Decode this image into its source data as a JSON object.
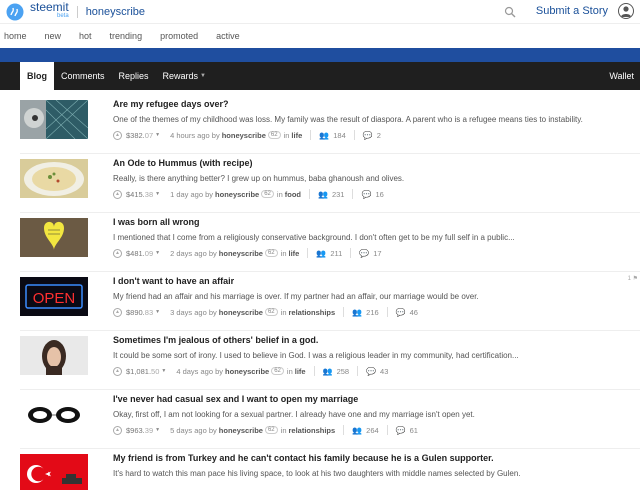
{
  "header": {
    "brand": "steemit",
    "beta": "beta",
    "account": "honeyscribe",
    "submit_label": "Submit a Story",
    "icons": [
      "steem-logo-icon",
      "search-icon",
      "user-avatar-icon"
    ]
  },
  "subnav": [
    "home",
    "new",
    "hot",
    "trending",
    "promoted",
    "active"
  ],
  "tabs": {
    "items": [
      "Blog",
      "Comments",
      "Replies",
      "Rewards"
    ],
    "active": "Blog",
    "wallet": "Wallet"
  },
  "colors": {
    "banner": "#1f4e9f",
    "tabbar": "#1f1f1f",
    "link": "#1a5099"
  },
  "posts": [
    {
      "title": "Are my refugee days over?",
      "body": "One of the themes of my childhood was loss. My family was the result of diaspora. A parent who is a refugee means ties to instability.",
      "payout_main": "$382.",
      "payout_cents": "07",
      "time": "4 hours ago by",
      "author": "honeyscribe",
      "rep": "62",
      "in": "in",
      "category": "life",
      "votes": "184",
      "comments": "2",
      "flag": ""
    },
    {
      "title": "An Ode to Hummus (with recipe)",
      "body": "Really, is there anything better? I grew up on hummus, baba ghanoush and olives.",
      "payout_main": "$415.",
      "payout_cents": "38",
      "time": "1 day ago by",
      "author": "honeyscribe",
      "rep": "62",
      "in": "in",
      "category": "food",
      "votes": "231",
      "comments": "16",
      "flag": ""
    },
    {
      "title": "I was born all wrong",
      "body": "I mentioned that I come from a religiously conservative background. I don't often get to be my full self in a public...",
      "payout_main": "$481.",
      "payout_cents": "09",
      "time": "2 days ago by",
      "author": "honeyscribe",
      "rep": "62",
      "in": "in",
      "category": "life",
      "votes": "211",
      "comments": "17",
      "flag": ""
    },
    {
      "title": "I don't want to have an affair",
      "body": "My friend had an affair and his marriage is over. If my partner had an affair, our marriage would be over.",
      "payout_main": "$890.",
      "payout_cents": "83",
      "time": "3 days ago by",
      "author": "honeyscribe",
      "rep": "62",
      "in": "in",
      "category": "relationships",
      "votes": "216",
      "comments": "46",
      "flag": "1"
    },
    {
      "title": "Sometimes I'm jealous of others' belief in a god.",
      "body": "It could be some sort of irony. I used to believe in God. I was a religious leader in my community, had certification...",
      "payout_main": "$1,081.",
      "payout_cents": "50",
      "time": "4 days ago by",
      "author": "honeyscribe",
      "rep": "62",
      "in": "in",
      "category": "life",
      "votes": "258",
      "comments": "43",
      "flag": ""
    },
    {
      "title": "I've never had casual sex and I want to open my marriage",
      "body": "Okay, first off, I am not looking for a sexual partner. I already have one and my marriage isn't open yet.",
      "payout_main": "$963.",
      "payout_cents": "39",
      "time": "5 days ago by",
      "author": "honeyscribe",
      "rep": "62",
      "in": "in",
      "category": "relationships",
      "votes": "264",
      "comments": "61",
      "flag": ""
    },
    {
      "title": "My friend is from Turkey and he can't contact his family because he is a Gulen supporter.",
      "body": "It's hard to watch this man pace his living space, to look at his two daughters with middle names selected by Gulen.",
      "payout_main": "",
      "payout_cents": "",
      "time": "",
      "author": "",
      "rep": "",
      "in": "",
      "category": "",
      "votes": "",
      "comments": "",
      "flag": ""
    }
  ]
}
